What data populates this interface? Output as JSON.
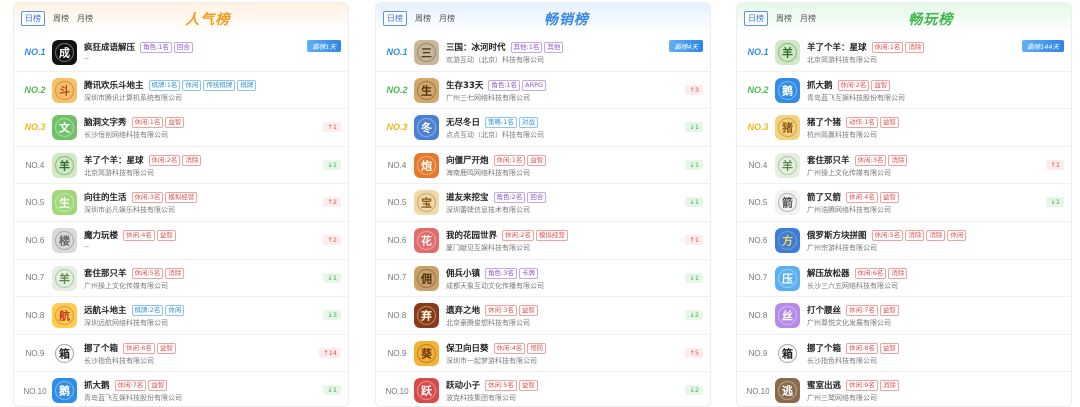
{
  "panels": [
    {
      "tabs": [
        "日榜",
        "周榜",
        "月榜"
      ],
      "title": "人气榜",
      "rows": [
        {
          "rank": "NO.1",
          "name": "疯狂成语解压",
          "tags": [
            {
              "text": "角色:1名",
              "c": "purple"
            },
            {
              "text": "回合",
              "c": "purple"
            }
          ],
          "company": "--",
          "change": "霸榜1天",
          "dir": "days",
          "icon": "idiom-icon"
        },
        {
          "rank": "NO.2",
          "name": "腾讯欢乐斗地主",
          "tags": [
            {
              "text": "棋牌:1名",
              "c": "blue"
            },
            {
              "text": "休闲",
              "c": "blue"
            },
            {
              "text": "传统棋牌",
              "c": "blue"
            },
            {
              "text": "棋牌",
              "c": "blue"
            }
          ],
          "company": "深圳市腾讯计算机系统有限公司",
          "change": "",
          "dir": "",
          "icon": "landlord-icon"
        },
        {
          "rank": "NO.3",
          "name": "脑洞文字秀",
          "tags": [
            {
              "text": "休闲:1名",
              "c": "red"
            },
            {
              "text": "益智",
              "c": "red"
            }
          ],
          "company": "长沙恒创网络科技有限公司",
          "change": "↑1",
          "dir": "down",
          "icon": "text-game-icon"
        },
        {
          "rank": "NO.4",
          "name": "羊了个羊：星球",
          "tags": [
            {
              "text": "休闲:2名",
              "c": "red"
            },
            {
              "text": "消除",
              "c": "red"
            }
          ],
          "company": "北京简游科技有限公司",
          "change": "↓1",
          "dir": "up",
          "icon": "sheep-icon"
        },
        {
          "rank": "NO.5",
          "name": "向往的生活",
          "tags": [
            {
              "text": "休闲:3名",
              "c": "red"
            },
            {
              "text": "模拟经营",
              "c": "red"
            }
          ],
          "company": "深圳市必凡娱乐科技有限公司",
          "change": "↑2",
          "dir": "down",
          "icon": "life-icon"
        },
        {
          "rank": "NO.6",
          "name": "魔力玩楼",
          "tags": [
            {
              "text": "休闲:4名",
              "c": "red"
            },
            {
              "text": "益智",
              "c": "red"
            }
          ],
          "company": "--",
          "change": "↑2",
          "dir": "down",
          "icon": "tower-icon"
        },
        {
          "rank": "NO.7",
          "name": "套住那只羊",
          "tags": [
            {
              "text": "休闲:5名",
              "c": "red"
            },
            {
              "text": "消除",
              "c": "red"
            }
          ],
          "company": "广州操上文化传媒有限公司",
          "change": "↓1",
          "dir": "up",
          "icon": "trap-sheep-icon"
        },
        {
          "rank": "NO.8",
          "name": "远航斗地主",
          "tags": [
            {
              "text": "棋牌:2名",
              "c": "blue"
            },
            {
              "text": "休闲",
              "c": "blue"
            }
          ],
          "company": "深圳远航网络科技有限公司",
          "change": "↓3",
          "dir": "up",
          "icon": "voyage-icon"
        },
        {
          "rank": "NO.9",
          "name": "挪了个箱",
          "tags": [
            {
              "text": "休闲:6名",
              "c": "red"
            },
            {
              "text": "益智",
              "c": "red"
            }
          ],
          "company": "长沙指色科技有限公司",
          "change": "↑14",
          "dir": "down",
          "icon": "box-icon"
        },
        {
          "rank": "NO.10",
          "name": "抓大鹅",
          "tags": [
            {
              "text": "休闲:7名",
              "c": "red"
            },
            {
              "text": "益智",
              "c": "red"
            }
          ],
          "company": "青岛蓝飞互娱科技股份有限公司",
          "change": "↓1",
          "dir": "up",
          "icon": "goose-icon"
        }
      ]
    },
    {
      "tabs": [
        "日榜",
        "周榜",
        "月榜"
      ],
      "title": "畅销榜",
      "rows": [
        {
          "rank": "NO.1",
          "name": "三国：冰河时代",
          "tags": [
            {
              "text": "其他:1名",
              "c": "purple"
            },
            {
              "text": "其他",
              "c": "purple"
            }
          ],
          "company": "欢游互动（北京）科技有限公司",
          "change": "霸榜4天",
          "dir": "days",
          "icon": "three-kingdoms-icon"
        },
        {
          "rank": "NO.2",
          "name": "生存33天",
          "tags": [
            {
              "text": "角色:1名",
              "c": "purple"
            },
            {
              "text": "ARPG",
              "c": "purple"
            }
          ],
          "company": "广州三七网络科技有限公司",
          "change": "↑3",
          "dir": "down",
          "icon": "survival-icon"
        },
        {
          "rank": "NO.3",
          "name": "无尽冬日",
          "tags": [
            {
              "text": "策略:1名",
              "c": "blue"
            },
            {
              "text": "对战",
              "c": "blue"
            }
          ],
          "company": "点点互动（北京）科技有限公司",
          "change": "↓1",
          "dir": "up",
          "icon": "winter-icon"
        },
        {
          "rank": "NO.4",
          "name": "向僵尸开炮",
          "tags": [
            {
              "text": "休闲:1名",
              "c": "red"
            },
            {
              "text": "益智",
              "c": "red"
            }
          ],
          "company": "海南鹿鸣网络科技有限公司",
          "change": "↓1",
          "dir": "up",
          "icon": "zombie-icon"
        },
        {
          "rank": "NO.5",
          "name": "道友来挖宝",
          "tags": [
            {
              "text": "角色:2名",
              "c": "purple"
            },
            {
              "text": "回合",
              "c": "purple"
            }
          ],
          "company": "深圳蕾婕信息技术有限公司",
          "change": "↓1",
          "dir": "up",
          "icon": "treasure-icon"
        },
        {
          "rank": "NO.6",
          "name": "我的花园世界",
          "tags": [
            {
              "text": "休闲:2名",
              "c": "red"
            },
            {
              "text": "模拟经营",
              "c": "red"
            }
          ],
          "company": "厦门献见互娱科技有限公司",
          "change": "↑1",
          "dir": "down",
          "icon": "garden-icon"
        },
        {
          "rank": "NO.7",
          "name": "佣兵小镇",
          "tags": [
            {
              "text": "角色:3名",
              "c": "purple"
            },
            {
              "text": "卡牌",
              "c": "purple"
            }
          ],
          "company": "成都天象互动文化传播有限公司",
          "change": "↓1",
          "dir": "up",
          "icon": "mercenary-icon"
        },
        {
          "rank": "NO.8",
          "name": "遗弃之地",
          "tags": [
            {
              "text": "休闲:3名",
              "c": "red"
            },
            {
              "text": "益智",
              "c": "red"
            }
          ],
          "company": "北京豪腾俊想科技有限公司",
          "change": "↓2",
          "dir": "up",
          "icon": "abandoned-icon"
        },
        {
          "rank": "NO.9",
          "name": "保卫向日葵",
          "tags": [
            {
              "text": "休闲:4名",
              "c": "red"
            },
            {
              "text": "塔防",
              "c": "red"
            }
          ],
          "company": "深圳市一起梦游科技有限公司",
          "change": "↑5",
          "dir": "down",
          "icon": "sunflower-icon"
        },
        {
          "rank": "NO.10",
          "name": "跃动小子",
          "tags": [
            {
              "text": "休闲:5名",
              "c": "red"
            },
            {
              "text": "益智",
              "c": "red"
            }
          ],
          "company": "波克科技集团有限公司",
          "change": "↓2",
          "dir": "up",
          "icon": "jump-kid-icon"
        }
      ]
    },
    {
      "tabs": [
        "日榜",
        "周榜",
        "月榜"
      ],
      "title": "畅玩榜",
      "rows": [
        {
          "rank": "NO.1",
          "name": "羊了个羊：星球",
          "tags": [
            {
              "text": "休闲:1名",
              "c": "red"
            },
            {
              "text": "消除",
              "c": "red"
            }
          ],
          "company": "北京简游科技有限公司",
          "change": "霸榜144天",
          "dir": "days",
          "icon": "sheep-icon"
        },
        {
          "rank": "NO.2",
          "name": "抓大鹅",
          "tags": [
            {
              "text": "休闲:2名",
              "c": "red"
            },
            {
              "text": "益智",
              "c": "red"
            }
          ],
          "company": "青岛蓝飞互娱科技股份有限公司",
          "change": "",
          "dir": "",
          "icon": "goose-icon"
        },
        {
          "rank": "NO.3",
          "name": "猪了个猪",
          "tags": [
            {
              "text": "动作:1名",
              "c": "red"
            },
            {
              "text": "益智",
              "c": "red"
            }
          ],
          "company": "杭州简赢科技有限公司",
          "change": "",
          "dir": "",
          "icon": "pig-icon"
        },
        {
          "rank": "NO.4",
          "name": "套住那只羊",
          "tags": [
            {
              "text": "休闲:3名",
              "c": "red"
            },
            {
              "text": "消除",
              "c": "red"
            }
          ],
          "company": "广州操上文化传媒有限公司",
          "change": "↑1",
          "dir": "down",
          "icon": "trap-sheep-icon"
        },
        {
          "rank": "NO.5",
          "name": "箭了又箭",
          "tags": [
            {
              "text": "休闲:4名",
              "c": "red"
            },
            {
              "text": "益智",
              "c": "red"
            }
          ],
          "company": "广州浩腾网络科技有限公司",
          "change": "↓1",
          "dir": "up",
          "icon": "arrow-icon"
        },
        {
          "rank": "NO.6",
          "name": "俄罗斯方块拼图",
          "tags": [
            {
              "text": "休闲:5名",
              "c": "red"
            },
            {
              "text": "消除",
              "c": "red"
            },
            {
              "text": "消除",
              "c": "red"
            },
            {
              "text": "休闲",
              "c": "red"
            }
          ],
          "company": "广州宗游科技有限公司",
          "change": "",
          "dir": "",
          "icon": "tetris-icon"
        },
        {
          "rank": "NO.7",
          "name": "解压放松器",
          "tags": [
            {
              "text": "休闲:6名",
              "c": "red"
            },
            {
              "text": "消除",
              "c": "red"
            }
          ],
          "company": "长沙三六五网络科技有限公司",
          "change": "",
          "dir": "",
          "icon": "relax-icon"
        },
        {
          "rank": "NO.8",
          "name": "打个腰丝",
          "tags": [
            {
              "text": "休闲:7名",
              "c": "red"
            },
            {
              "text": "益智",
              "c": "red"
            }
          ],
          "company": "广州尊悦文化发展有限公司",
          "change": "",
          "dir": "",
          "icon": "screw-icon"
        },
        {
          "rank": "NO.9",
          "name": "挪了个箱",
          "tags": [
            {
              "text": "休闲:8名",
              "c": "red"
            },
            {
              "text": "益智",
              "c": "red"
            }
          ],
          "company": "长沙指色科技有限公司",
          "change": "",
          "dir": "",
          "icon": "box-icon"
        },
        {
          "rank": "NO.10",
          "name": "蜜室出逃",
          "tags": [
            {
              "text": "休闲:9名",
              "c": "red"
            },
            {
              "text": "消除",
              "c": "red"
            }
          ],
          "company": "广州三鹭网络有限公司",
          "change": "",
          "dir": "",
          "icon": "escape-icon"
        }
      ]
    }
  ]
}
